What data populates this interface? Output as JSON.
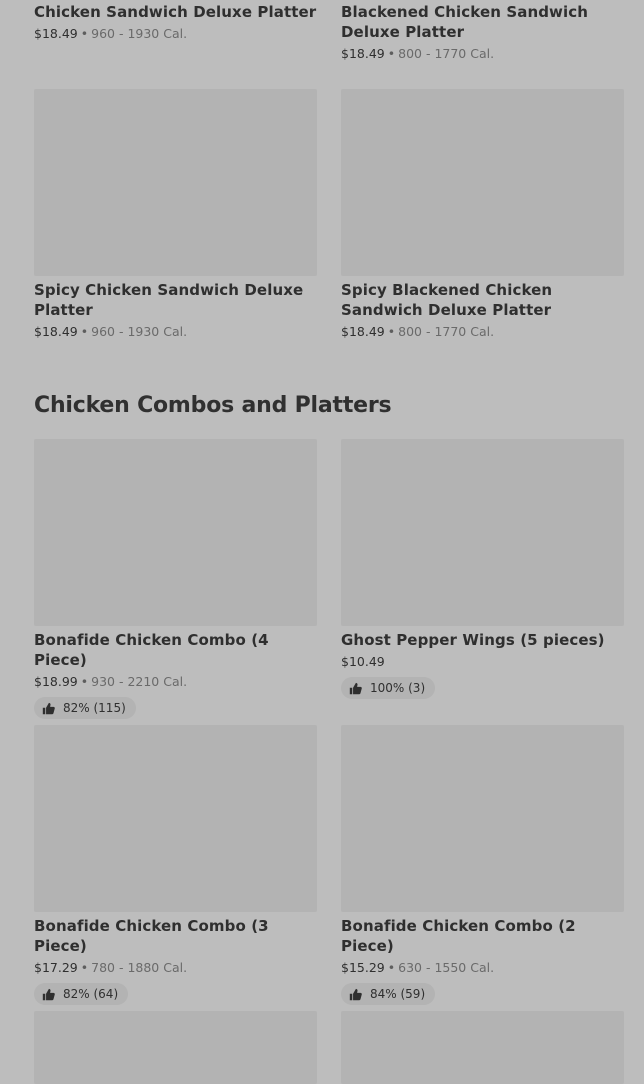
{
  "top_row": [
    {
      "title": "Chicken Sandwich Deluxe Platter",
      "price": "$18.49",
      "calories": "960 - 1930 Cal."
    },
    {
      "title": "Blackened Chicken Sandwich Deluxe Platter",
      "price": "$18.49",
      "calories": "800 - 1770 Cal."
    }
  ],
  "row2": [
    {
      "title": "Spicy Chicken Sandwich Deluxe Platter",
      "price": "$18.49",
      "calories": "960 - 1930 Cal."
    },
    {
      "title": "Spicy Blackened Chicken Sandwich Deluxe Platter",
      "price": "$18.49",
      "calories": "800 - 1770 Cal."
    }
  ],
  "section": {
    "title": "Chicken Combos and Platters"
  },
  "row3": [
    {
      "title": "Bonafide Chicken Combo (4 Piece)",
      "price": "$18.99",
      "calories": "930 - 2210 Cal.",
      "rating": "82% (115)"
    },
    {
      "title": "Ghost Pepper Wings (5 pieces)",
      "price": "$10.49",
      "calories": "",
      "rating": "100% (3)"
    }
  ],
  "row4": [
    {
      "title": "Bonafide Chicken Combo (3 Piece)",
      "price": "$17.29",
      "calories": "780 - 1880 Cal.",
      "rating": "82% (64)"
    },
    {
      "title": "Bonafide Chicken Combo (2 Piece)",
      "price": "$15.29",
      "calories": "630 - 1550 Cal.",
      "rating": "84% (59)"
    }
  ],
  "separator": "•",
  "icons": {
    "rating": "thumbs-up-icon"
  }
}
